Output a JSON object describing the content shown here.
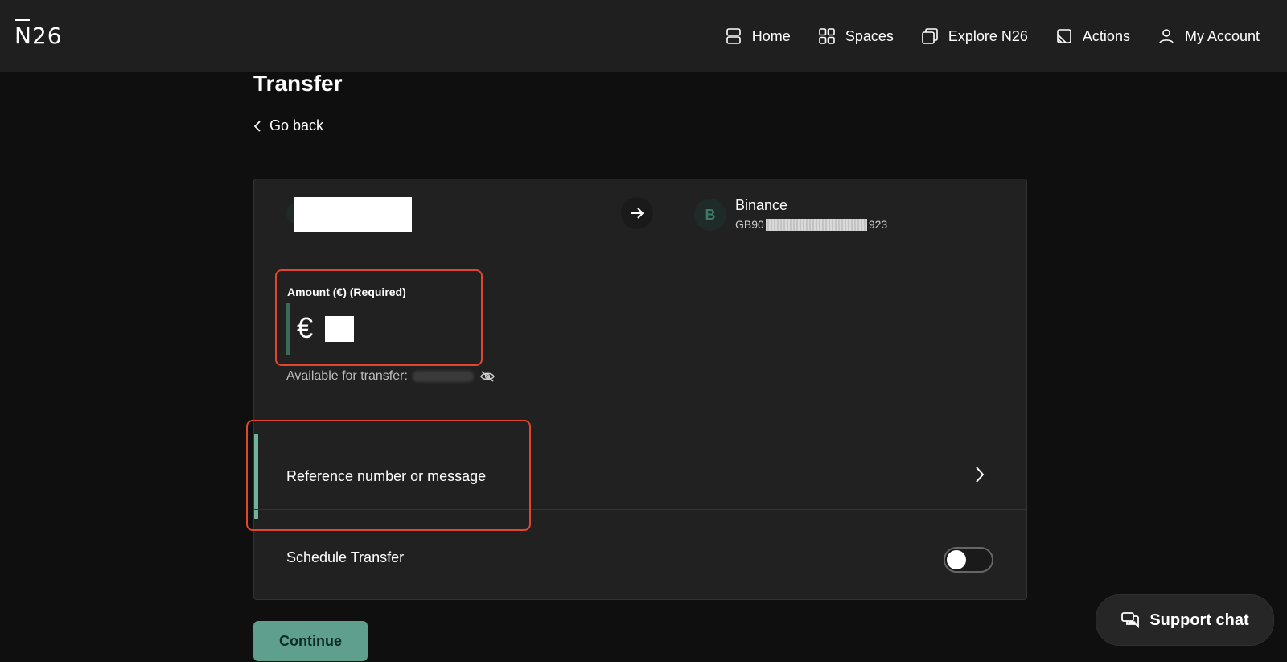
{
  "brand": {
    "logo": "N26"
  },
  "nav": {
    "items": [
      {
        "label": "Home",
        "icon": "home-icon"
      },
      {
        "label": "Spaces",
        "icon": "spaces-icon"
      },
      {
        "label": "Explore N26",
        "icon": "explore-icon"
      },
      {
        "label": "Actions",
        "icon": "actions-icon"
      },
      {
        "label": "My Account",
        "icon": "account-icon"
      }
    ]
  },
  "page": {
    "title": "Transfer",
    "go_back": "Go back"
  },
  "transfer": {
    "recipient": {
      "initial": "B",
      "name": "Binance",
      "iban_prefix": "GB90",
      "iban_suffix": "923"
    },
    "amount": {
      "label": "Amount (€) (Required)",
      "currency_symbol": "€",
      "value": ""
    },
    "available_label": "Available for transfer:",
    "reference_label": "Reference number or message",
    "schedule_label": "Schedule Transfer",
    "schedule_enabled": false
  },
  "actions": {
    "continue_label": "Continue",
    "support_chat_label": "Support chat"
  },
  "colors": {
    "accent": "#5ea08d",
    "highlight_outline": "#e2462c",
    "background": "#0f0f0f",
    "card": "#212121"
  }
}
